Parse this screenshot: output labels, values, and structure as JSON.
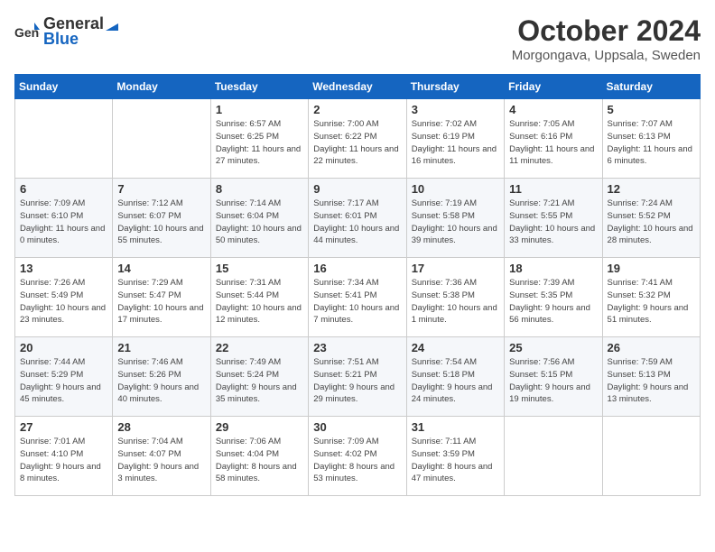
{
  "logo": {
    "general": "General",
    "blue": "Blue"
  },
  "title": "October 2024",
  "location": "Morgongava, Uppsala, Sweden",
  "days_of_week": [
    "Sunday",
    "Monday",
    "Tuesday",
    "Wednesday",
    "Thursday",
    "Friday",
    "Saturday"
  ],
  "weeks": [
    [
      {
        "day": "",
        "sunrise": "",
        "sunset": "",
        "daylight": ""
      },
      {
        "day": "",
        "sunrise": "",
        "sunset": "",
        "daylight": ""
      },
      {
        "day": "1",
        "sunrise": "Sunrise: 6:57 AM",
        "sunset": "Sunset: 6:25 PM",
        "daylight": "Daylight: 11 hours and 27 minutes."
      },
      {
        "day": "2",
        "sunrise": "Sunrise: 7:00 AM",
        "sunset": "Sunset: 6:22 PM",
        "daylight": "Daylight: 11 hours and 22 minutes."
      },
      {
        "day": "3",
        "sunrise": "Sunrise: 7:02 AM",
        "sunset": "Sunset: 6:19 PM",
        "daylight": "Daylight: 11 hours and 16 minutes."
      },
      {
        "day": "4",
        "sunrise": "Sunrise: 7:05 AM",
        "sunset": "Sunset: 6:16 PM",
        "daylight": "Daylight: 11 hours and 11 minutes."
      },
      {
        "day": "5",
        "sunrise": "Sunrise: 7:07 AM",
        "sunset": "Sunset: 6:13 PM",
        "daylight": "Daylight: 11 hours and 6 minutes."
      }
    ],
    [
      {
        "day": "6",
        "sunrise": "Sunrise: 7:09 AM",
        "sunset": "Sunset: 6:10 PM",
        "daylight": "Daylight: 11 hours and 0 minutes."
      },
      {
        "day": "7",
        "sunrise": "Sunrise: 7:12 AM",
        "sunset": "Sunset: 6:07 PM",
        "daylight": "Daylight: 10 hours and 55 minutes."
      },
      {
        "day": "8",
        "sunrise": "Sunrise: 7:14 AM",
        "sunset": "Sunset: 6:04 PM",
        "daylight": "Daylight: 10 hours and 50 minutes."
      },
      {
        "day": "9",
        "sunrise": "Sunrise: 7:17 AM",
        "sunset": "Sunset: 6:01 PM",
        "daylight": "Daylight: 10 hours and 44 minutes."
      },
      {
        "day": "10",
        "sunrise": "Sunrise: 7:19 AM",
        "sunset": "Sunset: 5:58 PM",
        "daylight": "Daylight: 10 hours and 39 minutes."
      },
      {
        "day": "11",
        "sunrise": "Sunrise: 7:21 AM",
        "sunset": "Sunset: 5:55 PM",
        "daylight": "Daylight: 10 hours and 33 minutes."
      },
      {
        "day": "12",
        "sunrise": "Sunrise: 7:24 AM",
        "sunset": "Sunset: 5:52 PM",
        "daylight": "Daylight: 10 hours and 28 minutes."
      }
    ],
    [
      {
        "day": "13",
        "sunrise": "Sunrise: 7:26 AM",
        "sunset": "Sunset: 5:49 PM",
        "daylight": "Daylight: 10 hours and 23 minutes."
      },
      {
        "day": "14",
        "sunrise": "Sunrise: 7:29 AM",
        "sunset": "Sunset: 5:47 PM",
        "daylight": "Daylight: 10 hours and 17 minutes."
      },
      {
        "day": "15",
        "sunrise": "Sunrise: 7:31 AM",
        "sunset": "Sunset: 5:44 PM",
        "daylight": "Daylight: 10 hours and 12 minutes."
      },
      {
        "day": "16",
        "sunrise": "Sunrise: 7:34 AM",
        "sunset": "Sunset: 5:41 PM",
        "daylight": "Daylight: 10 hours and 7 minutes."
      },
      {
        "day": "17",
        "sunrise": "Sunrise: 7:36 AM",
        "sunset": "Sunset: 5:38 PM",
        "daylight": "Daylight: 10 hours and 1 minute."
      },
      {
        "day": "18",
        "sunrise": "Sunrise: 7:39 AM",
        "sunset": "Sunset: 5:35 PM",
        "daylight": "Daylight: 9 hours and 56 minutes."
      },
      {
        "day": "19",
        "sunrise": "Sunrise: 7:41 AM",
        "sunset": "Sunset: 5:32 PM",
        "daylight": "Daylight: 9 hours and 51 minutes."
      }
    ],
    [
      {
        "day": "20",
        "sunrise": "Sunrise: 7:44 AM",
        "sunset": "Sunset: 5:29 PM",
        "daylight": "Daylight: 9 hours and 45 minutes."
      },
      {
        "day": "21",
        "sunrise": "Sunrise: 7:46 AM",
        "sunset": "Sunset: 5:26 PM",
        "daylight": "Daylight: 9 hours and 40 minutes."
      },
      {
        "day": "22",
        "sunrise": "Sunrise: 7:49 AM",
        "sunset": "Sunset: 5:24 PM",
        "daylight": "Daylight: 9 hours and 35 minutes."
      },
      {
        "day": "23",
        "sunrise": "Sunrise: 7:51 AM",
        "sunset": "Sunset: 5:21 PM",
        "daylight": "Daylight: 9 hours and 29 minutes."
      },
      {
        "day": "24",
        "sunrise": "Sunrise: 7:54 AM",
        "sunset": "Sunset: 5:18 PM",
        "daylight": "Daylight: 9 hours and 24 minutes."
      },
      {
        "day": "25",
        "sunrise": "Sunrise: 7:56 AM",
        "sunset": "Sunset: 5:15 PM",
        "daylight": "Daylight: 9 hours and 19 minutes."
      },
      {
        "day": "26",
        "sunrise": "Sunrise: 7:59 AM",
        "sunset": "Sunset: 5:13 PM",
        "daylight": "Daylight: 9 hours and 13 minutes."
      }
    ],
    [
      {
        "day": "27",
        "sunrise": "Sunrise: 7:01 AM",
        "sunset": "Sunset: 4:10 PM",
        "daylight": "Daylight: 9 hours and 8 minutes."
      },
      {
        "day": "28",
        "sunrise": "Sunrise: 7:04 AM",
        "sunset": "Sunset: 4:07 PM",
        "daylight": "Daylight: 9 hours and 3 minutes."
      },
      {
        "day": "29",
        "sunrise": "Sunrise: 7:06 AM",
        "sunset": "Sunset: 4:04 PM",
        "daylight": "Daylight: 8 hours and 58 minutes."
      },
      {
        "day": "30",
        "sunrise": "Sunrise: 7:09 AM",
        "sunset": "Sunset: 4:02 PM",
        "daylight": "Daylight: 8 hours and 53 minutes."
      },
      {
        "day": "31",
        "sunrise": "Sunrise: 7:11 AM",
        "sunset": "Sunset: 3:59 PM",
        "daylight": "Daylight: 8 hours and 47 minutes."
      },
      {
        "day": "",
        "sunrise": "",
        "sunset": "",
        "daylight": ""
      },
      {
        "day": "",
        "sunrise": "",
        "sunset": "",
        "daylight": ""
      }
    ]
  ]
}
